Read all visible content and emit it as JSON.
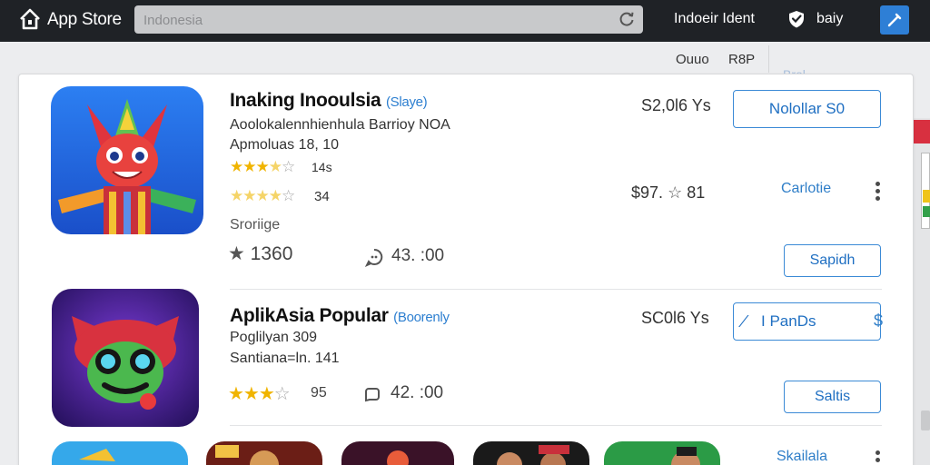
{
  "header": {
    "app_title": "App Store",
    "search_value": "Indonesia",
    "region": "Indoeir Ident",
    "user": "baiy"
  },
  "sort": {
    "label": "Ouuo",
    "value": "R8P",
    "faded_tab": "Brol"
  },
  "apps": [
    {
      "name": "Inaking Inooulsia",
      "tag": "(Slaye)",
      "developer": "Aoolokalennhienhula Barrioy NOA",
      "category": "Apmoluas 18, 10",
      "rating_count": "14s",
      "rating2_count": "34",
      "status": "Sroriige",
      "stat_value": "1360",
      "comments": "43. :00",
      "price": "S2,0l6 Ys",
      "price2": "$97.",
      "price2_rating": "81",
      "primary_button": "Nolollar S0",
      "link": "Carlotie",
      "secondary_button": "Sapidh"
    },
    {
      "name": "AplikAsia Popular",
      "tag": "(Boorenly",
      "developer": "Poglilyan 309",
      "category": "Santiana=ln. 141",
      "rating_count": "95",
      "comments": "42. :00",
      "price": "SC0l6 Ys",
      "primary_button": "I PanDs",
      "secondary_button": "Saltis"
    }
  ],
  "bottom": {
    "link": "Skailala"
  },
  "colors": {
    "accent": "#2e7fd6",
    "topbar": "#1f2226",
    "star": "#f0b400"
  }
}
